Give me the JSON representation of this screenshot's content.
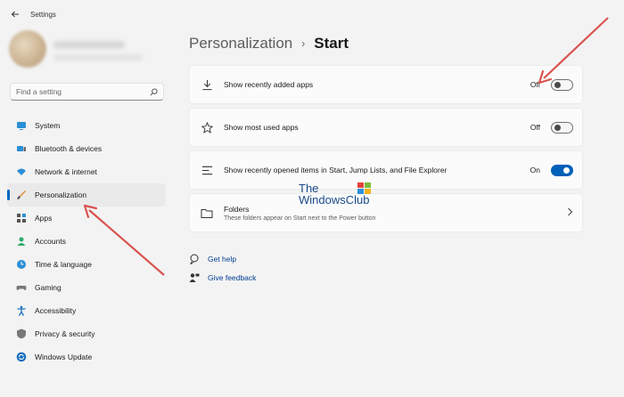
{
  "window": {
    "title": "Settings"
  },
  "search": {
    "placeholder": "Find a setting"
  },
  "sidebar": {
    "items": [
      {
        "label": "System",
        "icon": "monitor-icon"
      },
      {
        "label": "Bluetooth & devices",
        "icon": "bluetooth-devices-icon"
      },
      {
        "label": "Network & internet",
        "icon": "wifi-icon"
      },
      {
        "label": "Personalization",
        "icon": "paintbrush-icon",
        "active": true
      },
      {
        "label": "Apps",
        "icon": "apps-icon"
      },
      {
        "label": "Accounts",
        "icon": "person-icon"
      },
      {
        "label": "Time & language",
        "icon": "globe-clock-icon"
      },
      {
        "label": "Gaming",
        "icon": "gamepad-icon"
      },
      {
        "label": "Accessibility",
        "icon": "accessibility-icon"
      },
      {
        "label": "Privacy & security",
        "icon": "shield-icon"
      },
      {
        "label": "Windows Update",
        "icon": "sync-icon"
      }
    ]
  },
  "breadcrumb": {
    "parent": "Personalization",
    "separator": "›",
    "current": "Start"
  },
  "settings": [
    {
      "label": "Show recently added apps",
      "state": "Off",
      "on": false,
      "icon": "download-icon"
    },
    {
      "label": "Show most used apps",
      "state": "Off",
      "on": false,
      "icon": "star-icon"
    },
    {
      "label": "Show recently opened items in Start, Jump Lists, and File Explorer",
      "state": "On",
      "on": true,
      "icon": "list-icon"
    }
  ],
  "folders": {
    "title": "Folders",
    "subtitle": "These folders appear on Start next to the Power button",
    "icon": "folder-icon"
  },
  "links": {
    "help": "Get help",
    "feedback": "Give feedback"
  },
  "watermark": {
    "line1": "The",
    "line2": "WindowsClub"
  },
  "colors": {
    "accent": "#0067c0",
    "toggle_on": "#005fb8",
    "annotation_arrow": "#d9534f",
    "link": "#003e92"
  }
}
